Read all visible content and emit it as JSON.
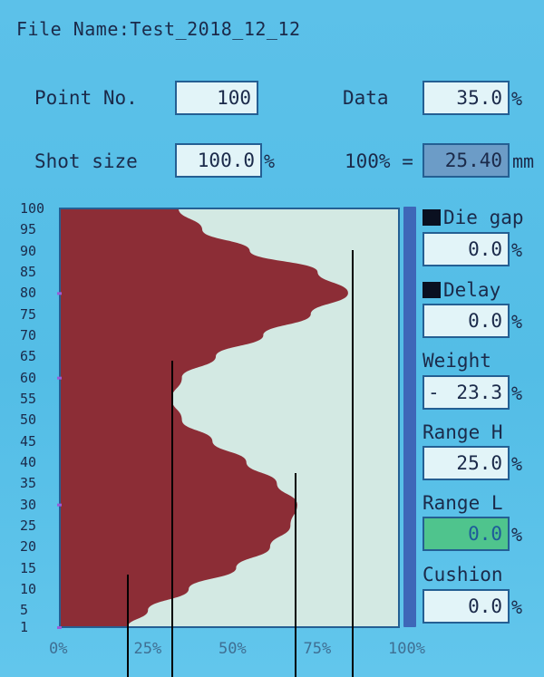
{
  "header": {
    "file_name": "File Name:Test_2018_12_12"
  },
  "fields": {
    "point_no": {
      "label": "Point No.",
      "value": "100"
    },
    "data": {
      "label": "Data",
      "value": "35.0",
      "unit": "%"
    },
    "shot_size": {
      "label": "Shot size",
      "value": "100.0",
      "unit": "%"
    },
    "hundred_pct": {
      "label": "100% =",
      "value": "25.40",
      "unit": "mm"
    }
  },
  "side_panel": {
    "die_gap": {
      "label": "Die gap",
      "value": "0.0",
      "unit": "%"
    },
    "delay": {
      "label": "Delay",
      "value": "0.0",
      "unit": "%"
    },
    "weight": {
      "label": "Weight",
      "sign": "-",
      "value": "23.3",
      "unit": "%"
    },
    "range_h": {
      "label": "Range H",
      "value": "25.0",
      "unit": "%"
    },
    "range_l": {
      "label": "Range L",
      "value": "0.0",
      "unit": "%"
    },
    "cushion": {
      "label": "Cushion",
      "value": "0.0",
      "unit": "%"
    }
  },
  "colors": {
    "profile_fill": "#8c2d36",
    "plot_bg": "#d3e9e3",
    "accent_bar": "#3e67b8",
    "range_l_bg": "#4fc48d"
  },
  "chart_data": {
    "type": "area",
    "y_ticks": [
      "100",
      "95",
      "90",
      "85",
      "80",
      "75",
      "70",
      "65",
      "60",
      "55",
      "50",
      "45",
      "40",
      "35",
      "30",
      "25",
      "20",
      "15",
      "10",
      "5",
      "1"
    ],
    "x_ticks": [
      "0%",
      "25%",
      "50%",
      "75%",
      "100%"
    ],
    "ylim": [
      1,
      100
    ],
    "xlim": [
      0,
      100
    ],
    "profile": {
      "y": [
        1,
        5,
        10,
        15,
        20,
        25,
        30,
        35,
        40,
        45,
        50,
        55,
        60,
        65,
        70,
        75,
        80,
        85,
        90,
        95,
        100
      ],
      "x": [
        20,
        26,
        38,
        52,
        62,
        68,
        70,
        64,
        55,
        45,
        36,
        33,
        36,
        46,
        60,
        74,
        85,
        76,
        56,
        42,
        35
      ]
    }
  }
}
